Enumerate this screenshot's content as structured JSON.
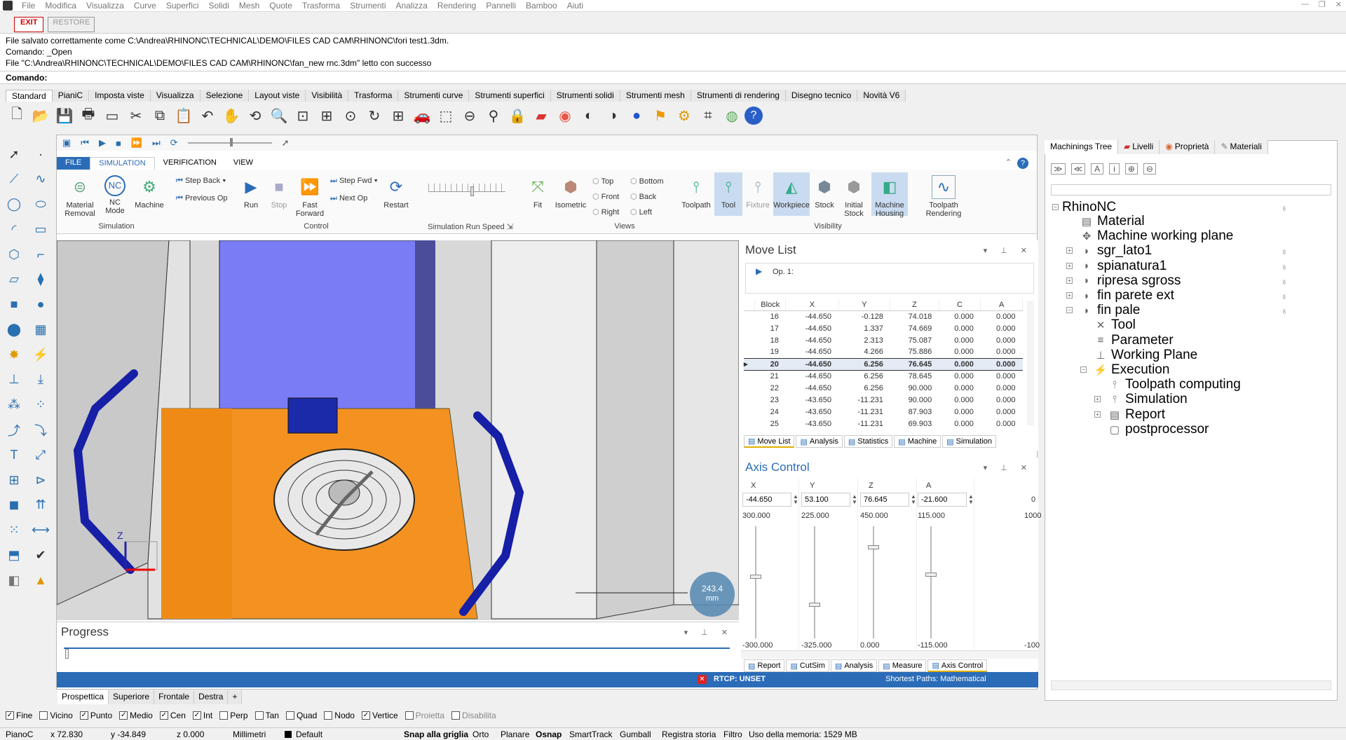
{
  "menu": {
    "items": [
      "File",
      "Modifica",
      "Visualizza",
      "Curve",
      "Superfici",
      "Solidi",
      "Mesh",
      "Quote",
      "Trasforma",
      "Strumenti",
      "Analizza",
      "Rendering",
      "Pannelli",
      "Bamboo",
      "Aiuti"
    ]
  },
  "exit_row": {
    "exit": "EXIT",
    "restore": "RESTORE"
  },
  "command_history": [
    "File salvato correttamente come C:\\Andrea\\RHINONC\\TECHNICAL\\DEMO\\FILES CAD CAM\\RHINONC\\fori test1.3dm.",
    "Comando: _Open",
    "File \"C:\\Andrea\\RHINONC\\TECHNICAL\\DEMO\\FILES CAD CAM\\RHINONC\\fan_new rnc.3dm\" letto con successo"
  ],
  "command_prompt": "Comando:",
  "toolbar_tabs": [
    "Standard",
    "PianiC",
    "Imposta viste",
    "Visualizza",
    "Selezione",
    "Layout viste",
    "Visibilità",
    "Trasforma",
    "Strumenti curve",
    "Strumenti superfici",
    "Strumenti solidi",
    "Strumenti mesh",
    "Strumenti di rendering",
    "Disegno tecnico",
    "Novità V6"
  ],
  "ribbon": {
    "tabs": [
      "FILE",
      "SIMULATION",
      "VERIFICATION",
      "VIEW"
    ],
    "material_removal": "Material Removal",
    "nc_mode": "NC Mode",
    "machine": "Machine",
    "simulation_group": "Simulation",
    "step_back": "Step Back",
    "previous_op": "Previous Op",
    "run": "Run",
    "stop": "Stop",
    "fast_forward": "Fast Forward",
    "step_fwd": "Step Fwd",
    "next_op": "Next Op",
    "restart": "Restart",
    "control_group": "Control",
    "speed_group": "Simulation Run Speed",
    "fit": "Fit",
    "isometric": "Isometric",
    "top": "Top",
    "front": "Front",
    "right": "Right",
    "bottom": "Bottom",
    "back": "Back",
    "left": "Left",
    "views_group": "Views",
    "toolpath": "Toolpath",
    "tool": "Tool",
    "fixture": "Fixture",
    "workpiece": "Workpiece",
    "stock": "Stock",
    "initial_stock": "Initial Stock",
    "machine_housing": "Machine Housing",
    "visibility_group": "Visibility",
    "toolpath_rendering": "Toolpath Rendering"
  },
  "viewport": {
    "measure_value": "243.4",
    "measure_unit": "mm",
    "axis_z": "Z"
  },
  "move_list": {
    "title": "Move List",
    "op": "Op. 1:",
    "columns": [
      "Block",
      "X",
      "Y",
      "Z",
      "C",
      "A"
    ],
    "rows": [
      [
        "16",
        "-44.650",
        "-0.128",
        "74.018",
        "0.000",
        "0.000"
      ],
      [
        "17",
        "-44.650",
        "1.337",
        "74.669",
        "0.000",
        "0.000"
      ],
      [
        "18",
        "-44.650",
        "2.313",
        "75.087",
        "0.000",
        "0.000"
      ],
      [
        "19",
        "-44.650",
        "4.266",
        "75.886",
        "0.000",
        "0.000"
      ],
      [
        "20",
        "-44.650",
        "6.256",
        "76.645",
        "0.000",
        "0.000"
      ],
      [
        "21",
        "-44.650",
        "6.256",
        "78.645",
        "0.000",
        "0.000"
      ],
      [
        "22",
        "-44.650",
        "6.256",
        "90.000",
        "0.000",
        "0.000"
      ],
      [
        "23",
        "-43.650",
        "-11.231",
        "90.000",
        "0.000",
        "0.000"
      ],
      [
        "24",
        "-43.650",
        "-11.231",
        "87.903",
        "0.000",
        "0.000"
      ],
      [
        "25",
        "-43.650",
        "-11.231",
        "69.903",
        "0.000",
        "0.000"
      ]
    ],
    "current_row_index": 4,
    "tabs": [
      "Move List",
      "Analysis",
      "Statistics",
      "Machine",
      "Simulation"
    ]
  },
  "axis_control": {
    "title": "Axis Control",
    "axes": [
      {
        "name": "X",
        "value": "-44.650",
        "max": "300.000",
        "min": "-300.000",
        "level": 0.43
      },
      {
        "name": "Y",
        "value": "53.100",
        "max": "225.000",
        "min": "-325.000",
        "level": 0.68
      },
      {
        "name": "Z",
        "value": "76.645",
        "max": "450.000",
        "min": "0.000",
        "level": 0.17
      },
      {
        "name": "A",
        "value": "-21.600",
        "max": "115.000",
        "min": "-115.000",
        "level": 0.41
      }
    ],
    "extra_max": "1000",
    "extra_min": "-100",
    "extra_val": "0",
    "tabs": [
      "Report",
      "CutSim",
      "Analysis",
      "Measure",
      "Axis Control"
    ]
  },
  "progress": {
    "title": "Progress"
  },
  "statusbar": {
    "rtcp": "RTCP: UNSET",
    "shortest": "Shortest Paths: Mathematical"
  },
  "machinings_tree": {
    "tabs": [
      "Machinings Tree",
      "Livelli",
      "Proprietà",
      "Materiali"
    ],
    "root": "RhinoNC",
    "nodes": [
      "Material",
      "Machine working plane",
      "sgr_lato1",
      "spianatura1",
      "ripresa sgross",
      "fin parete ext",
      "fin pale",
      "Tool",
      "Parameter",
      "Working Plane",
      "Execution",
      "Toolpath computing",
      "Simulation",
      "Report",
      "postprocessor"
    ]
  },
  "view_tabs": [
    "Prospettica",
    "Superiore",
    "Frontale",
    "Destra"
  ],
  "osnap": [
    {
      "label": "Fine",
      "on": true
    },
    {
      "label": "Vicino",
      "on": false
    },
    {
      "label": "Punto",
      "on": true
    },
    {
      "label": "Medio",
      "on": true
    },
    {
      "label": "Cen",
      "on": true
    },
    {
      "label": "Int",
      "on": true
    },
    {
      "label": "Perp",
      "on": false
    },
    {
      "label": "Tan",
      "on": false
    },
    {
      "label": "Quad",
      "on": false
    },
    {
      "label": "Nodo",
      "on": false
    },
    {
      "label": "Vertice",
      "on": true
    },
    {
      "label": "Proietta",
      "on": false
    },
    {
      "label": "Disabilita",
      "on": false
    }
  ],
  "status": {
    "cplane": "PianoC",
    "x": "x 72.830",
    "y": "y -34.849",
    "z": "z 0.000",
    "units": "Millimetri",
    "layer": "Default",
    "snap": "Snap alla griglia",
    "orto": "Orto",
    "planare": "Planare",
    "osnap": "Osnap",
    "smarttrack": "SmartTrack",
    "gumball": "Gumball",
    "history": "Registra storia",
    "filtro": "Filtro",
    "memory": "Uso della memoria: 1529 MB"
  }
}
